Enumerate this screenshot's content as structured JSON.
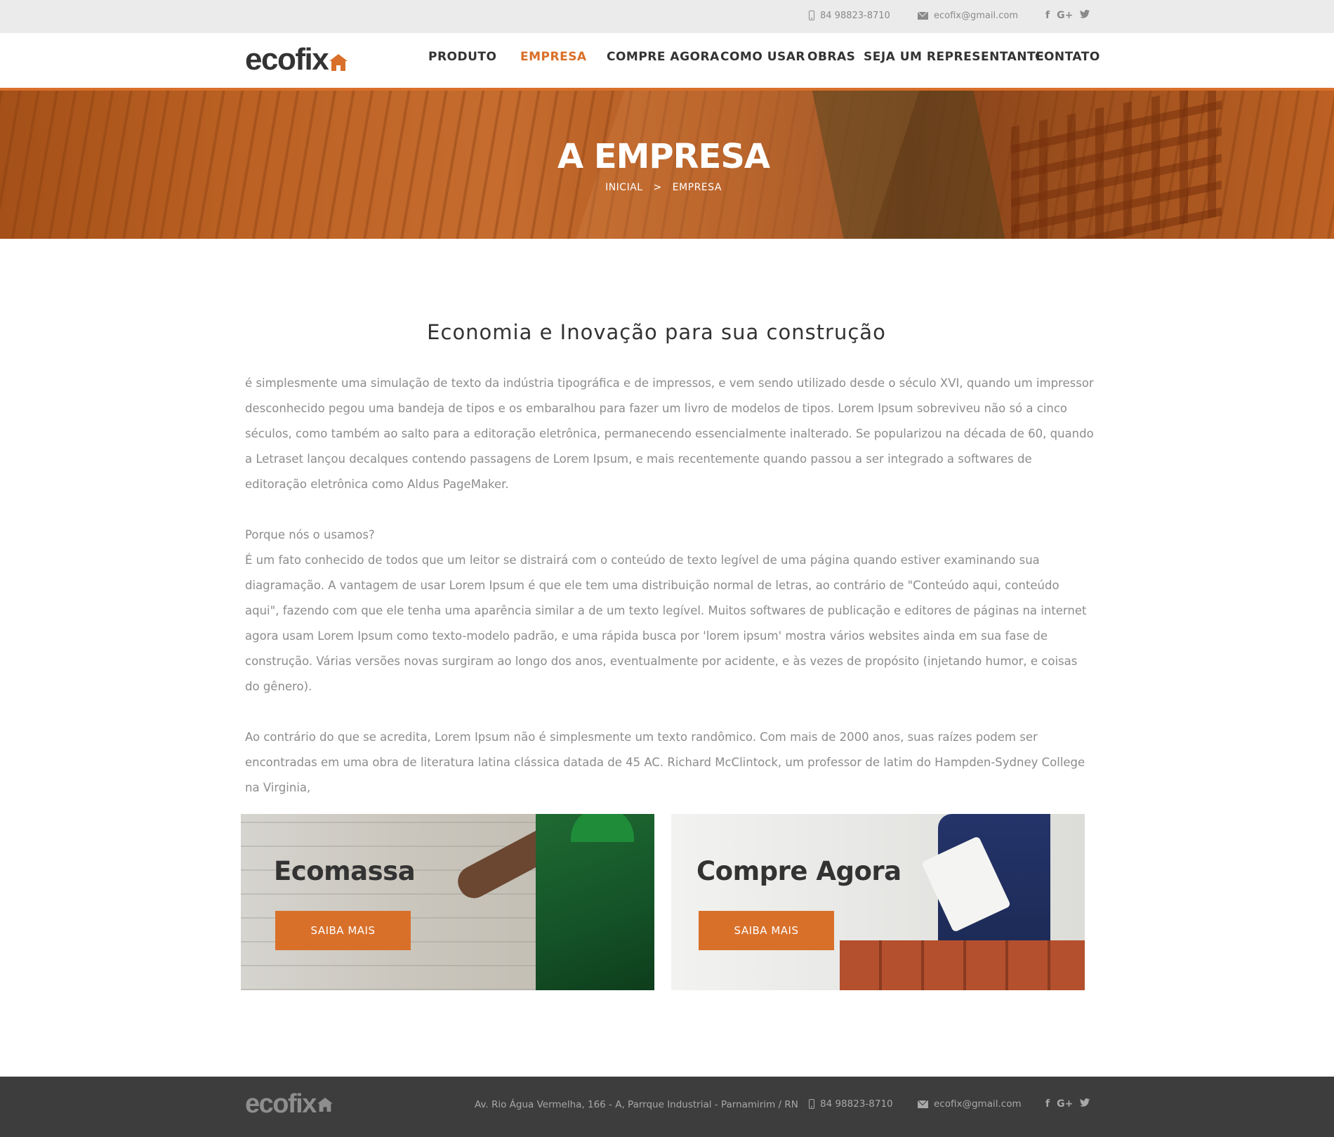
{
  "topbar": {
    "phone": "84 98823-8710",
    "email": "ecofix@gmail.com",
    "social": {
      "facebook": "f",
      "google": "G+",
      "twitter": "t"
    }
  },
  "header": {
    "logo": "ecofix",
    "nav": [
      {
        "label": "PRODUTO",
        "active": false
      },
      {
        "label": "EMPRESA",
        "active": true
      },
      {
        "label": "COMPRE AGORA",
        "active": false
      },
      {
        "label": "COMO USAR",
        "active": false
      },
      {
        "label": "OBRAS",
        "active": false
      },
      {
        "label": "SEJA UM REPRESENTANTE",
        "active": false
      },
      {
        "label": "CONTATO",
        "active": false
      }
    ]
  },
  "hero": {
    "title": "A EMPRESA",
    "breadcrumb": {
      "home": "INICIAL",
      "separator": ">",
      "current": "EMPRESA"
    }
  },
  "main": {
    "title": "Economia e Inovação para sua construção",
    "paragraphs": [
      "é simplesmente uma simulação de texto da indústria tipográfica e de impressos, e vem sendo utilizado desde o século XVI, quando um impressor desconhecido pegou uma bandeja de tipos e os embaralhou para fazer um livro de modelos de tipos. Lorem Ipsum sobreviveu não só a cinco séculos, como também ao salto para a editoração eletrônica, permanecendo essencialmente inalterado. Se popularizou na década de 60, quando a Letraset lançou decalques contendo passagens de Lorem Ipsum, e mais recentemente quando passou a ser integrado a softwares de editoração eletrônica como Aldus PageMaker.",
      "Porque nós o usamos?",
      "É um fato conhecido de todos que um leitor se distrairá com o conteúdo de texto legível de uma página quando estiver examinando sua diagramação. A vantagem de usar Lorem Ipsum é que ele tem uma distribuição normal de letras, ao contrário de \"Conteúdo aqui, conteúdo aqui\", fazendo com que ele tenha uma aparência similar a de um texto legível. Muitos softwares de publicação e editores de páginas na internet agora usam Lorem Ipsum como texto-modelo padrão, e uma rápida busca por 'lorem ipsum' mostra vários websites ainda em sua fase de construção. Várias versões novas surgiram ao longo dos anos, eventualmente por acidente, e às vezes de propósito (injetando humor, e coisas do gênero).",
      "Ao contrário do que se acredita, Lorem Ipsum não é simplesmente um texto randômico. Com mais de 2000 anos, suas raízes podem ser encontradas em uma obra de literatura latina clássica datada de 45 AC. Richard McClintock, um professor de latim do Hampden-Sydney College na Virginia,"
    ]
  },
  "cards": [
    {
      "title": "Ecomassa",
      "button": "SAIBA MAIS"
    },
    {
      "title": "Compre Agora",
      "button": "SAIBA MAIS"
    }
  ],
  "footer": {
    "logo": "ecofix",
    "address": "Av. Rio Água Vermelha, 166 - A, Parrque Industrial - Parnamirim / RN",
    "phone": "84 98823-8710",
    "email": "ecofix@gmail.com",
    "social": {
      "facebook": "f",
      "google": "G+",
      "twitter": "t"
    }
  },
  "colors": {
    "accent": "#d9702a",
    "topbar": "#ebebeb",
    "footer": "#3d3d3d",
    "text": "#333333",
    "body_text": "#8c8c8c"
  }
}
